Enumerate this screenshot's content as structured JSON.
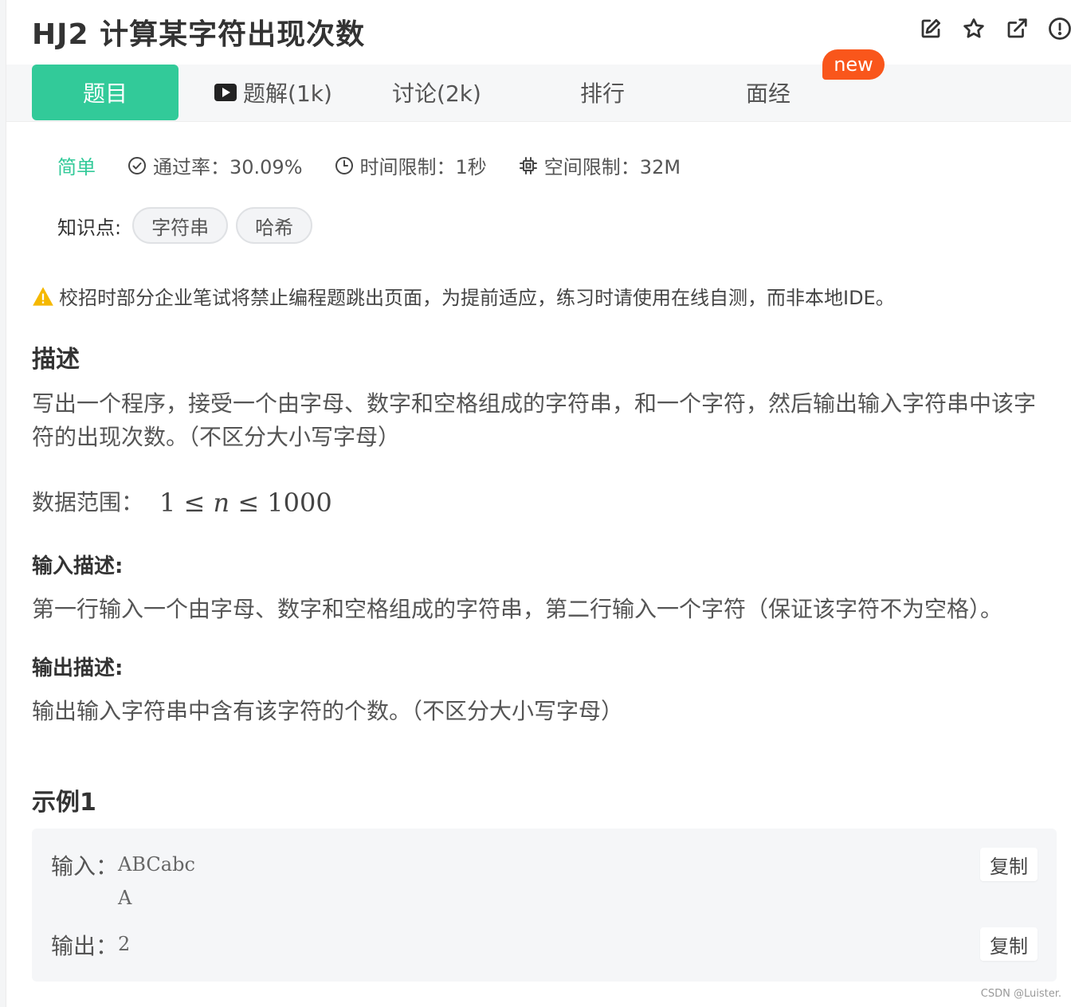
{
  "header": {
    "title": "HJ2  计算某字符出现次数",
    "icons": [
      "edit-icon",
      "star-icon",
      "share-icon",
      "info-icon"
    ]
  },
  "tabs": [
    {
      "label": "题目",
      "active": true
    },
    {
      "label": "题解(1k)",
      "icon": "video-icon"
    },
    {
      "label": "讨论(2k)"
    },
    {
      "label": "排行"
    },
    {
      "label": "面经"
    }
  ],
  "new_badge": "new",
  "meta": {
    "difficulty": "简单",
    "pass_rate": "通过率：30.09%",
    "time_limit": "时间限制：1秒",
    "memory_limit": "空间限制：32M"
  },
  "knowledge": {
    "label": "知识点:",
    "tags": [
      "字符串",
      "哈希"
    ]
  },
  "warning": "校招时部分企业笔试将禁止编程题跳出页面，为提前适应，练习时请使用在线自测，而非本地IDE。",
  "description": {
    "heading": "描述",
    "text": "写出一个程序，接受一个由字母、数字和空格组成的字符串，和一个字符，然后输出输入字符串中该字符的出现次数。（不区分大小写字母）",
    "range_label": "数据范围：",
    "range_math": {
      "low": "1",
      "var": "n",
      "high": "1000",
      "op": "≤"
    }
  },
  "input_desc": {
    "heading": "输入描述:",
    "text": "第一行输入一个由字母、数字和空格组成的字符串，第二行输入一个字符（保证该字符不为空格）。"
  },
  "output_desc": {
    "heading": "输出描述:",
    "text": "输出输入字符串中含有该字符的个数。（不区分大小写字母）"
  },
  "example": {
    "heading": "示例1",
    "input_label": "输入：",
    "input_value": "ABCabc\nA",
    "output_label": "输出：",
    "output_value": "2",
    "copy_label": "复制"
  },
  "watermark": "CSDN @Luister.",
  "colors": {
    "accent": "#32ca99",
    "badge": "#f9561b"
  }
}
